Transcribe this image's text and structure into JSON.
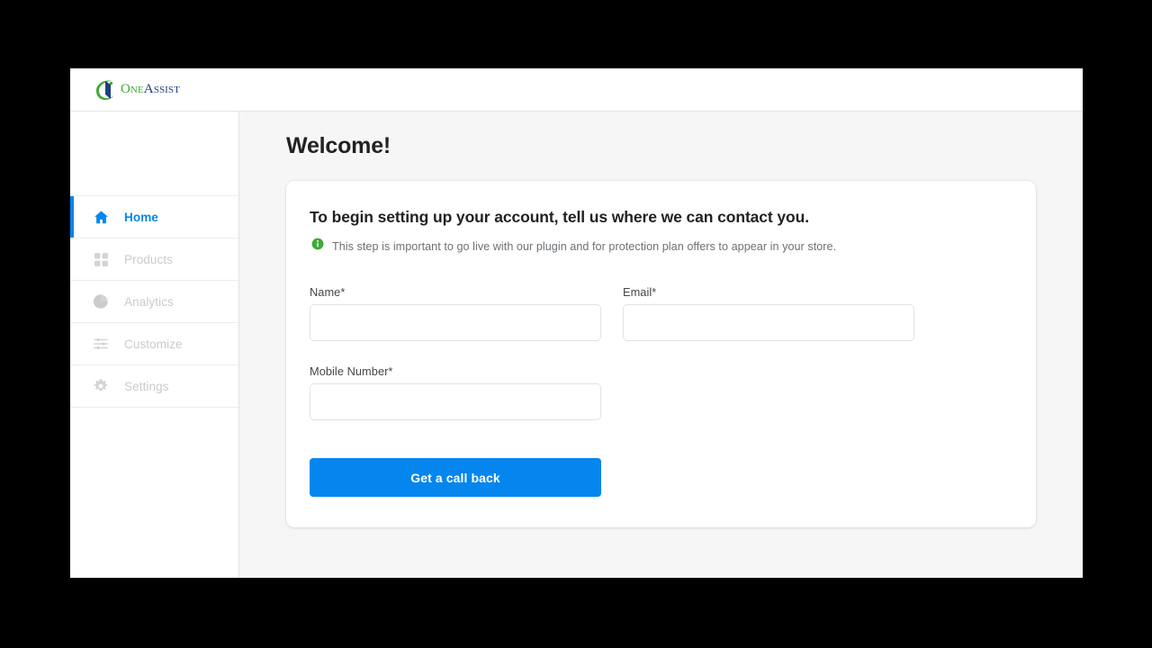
{
  "colors": {
    "accent_blue": "#0586ee",
    "page_bg": "#f6f6f7",
    "card_bg": "#ffffff",
    "info_green": "#3faa35",
    "heading_text": "#202223",
    "muted_text": "#6d7175",
    "nav_inactive": "#c9cbcd",
    "letterbox": "#000000"
  },
  "brand": {
    "icon": "oneassist-swoosh-logo-icon",
    "name_first": "One",
    "name_second": "Assist"
  },
  "sidebar": {
    "items": [
      {
        "label": "Home",
        "icon": "home-icon",
        "active": true
      },
      {
        "label": "Products",
        "icon": "grid-icon",
        "active": false
      },
      {
        "label": "Analytics",
        "icon": "pie-chart-icon",
        "active": false
      },
      {
        "label": "Customize",
        "icon": "sliders-icon",
        "active": false
      },
      {
        "label": "Settings",
        "icon": "gear-icon",
        "active": false
      }
    ]
  },
  "main": {
    "page_title": "Welcome!",
    "card": {
      "heading": "To begin setting up your account, tell us where we can contact you.",
      "note_icon": "info-circle-icon",
      "note": "This step is important to go live with our plugin and for protection plan offers to appear in your store.",
      "fields": [
        {
          "label": "Name*",
          "value": "",
          "placeholder": ""
        },
        {
          "label": "Email*",
          "value": "",
          "placeholder": ""
        },
        {
          "label": "Mobile Number*",
          "value": "",
          "placeholder": ""
        }
      ],
      "submit_label": "Get a call back"
    }
  }
}
